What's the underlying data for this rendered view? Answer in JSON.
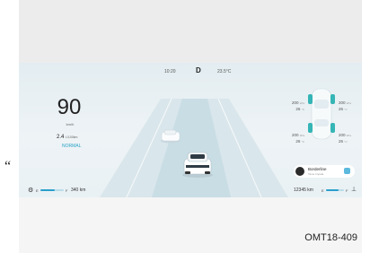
{
  "status_bar": {
    "time": "10:20",
    "gear": "D",
    "temperature": "23.5°C"
  },
  "speed": {
    "value": "90",
    "unit": "km/h"
  },
  "consumption": {
    "value": "2.4",
    "unit": "L/100km"
  },
  "drive_mode": "NORMAL",
  "tires": {
    "front_left": {
      "pressure": "200",
      "pressure_unit": "kPa",
      "temp": "26",
      "temp_unit": "°C"
    },
    "front_right": {
      "pressure": "200",
      "pressure_unit": "kPa",
      "temp": "26",
      "temp_unit": "°C"
    },
    "rear_left": {
      "pressure": "200",
      "pressure_unit": "kPa",
      "temp": "26",
      "temp_unit": "°C"
    },
    "rear_right": {
      "pressure": "200",
      "pressure_unit": "kPa",
      "temp": "26",
      "temp_unit": "°C"
    }
  },
  "media": {
    "title": "Borderline",
    "subtitle": "Tame Impala"
  },
  "battery": {
    "e_label": "E",
    "f_label": "F",
    "level_fraction": 0.6,
    "range": "340 km",
    "icon": "battery-icon"
  },
  "odometer": {
    "value": "12345 km"
  },
  "fuel": {
    "e_label": "E",
    "f_label": "F",
    "level_fraction": 0.7,
    "icon": "fuel-pump-icon"
  },
  "colors": {
    "accent": "#2aa0cc",
    "background": "#e6eff3"
  },
  "figure_id": "OMT18-409",
  "quote_mark": "“"
}
